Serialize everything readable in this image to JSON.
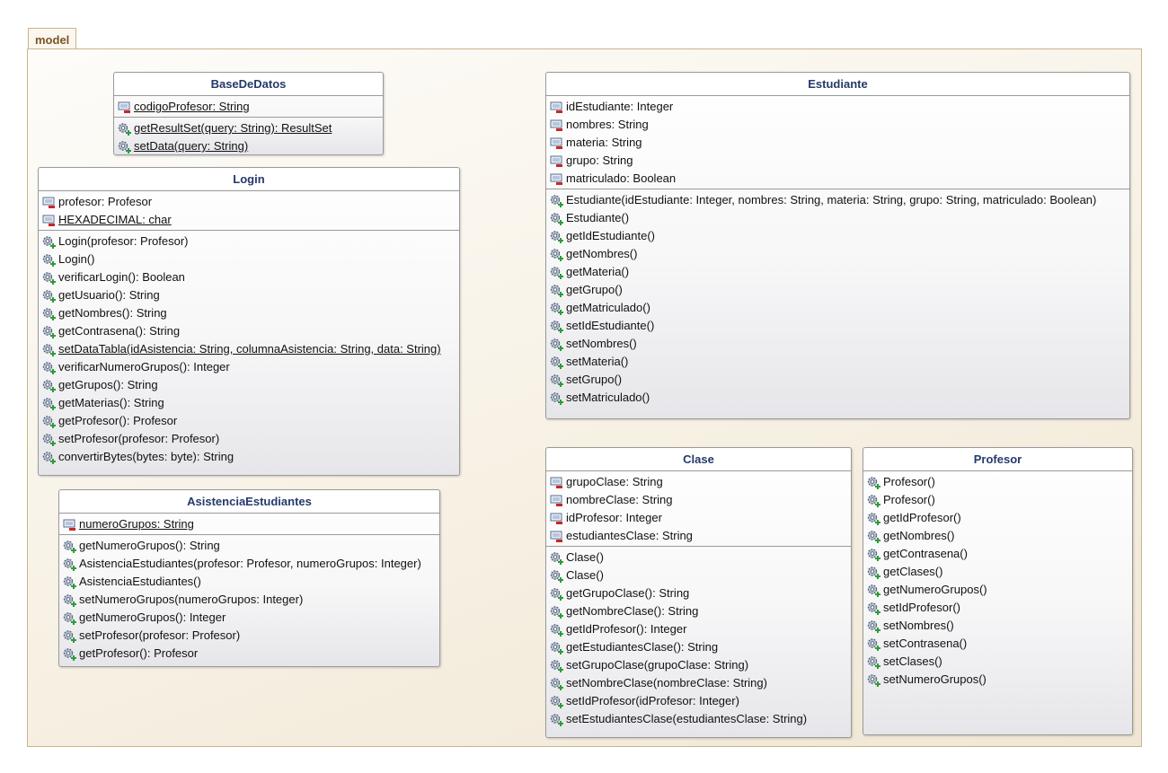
{
  "package": {
    "name": "model"
  },
  "classes": {
    "basededatos": {
      "name": "BaseDeDatos",
      "attributes": [
        {
          "text": "codigoProfesor: String",
          "underline": true
        }
      ],
      "methods": [
        {
          "text": "getResultSet(query: String): ResultSet",
          "underline": true
        },
        {
          "text": "setData(query: String)",
          "underline": true
        }
      ]
    },
    "login": {
      "name": "Login",
      "attributes": [
        {
          "text": "profesor: Profesor",
          "underline": false
        },
        {
          "text": "HEXADECIMAL: char",
          "underline": true
        }
      ],
      "methods": [
        {
          "text": "Login(profesor: Profesor)",
          "underline": false
        },
        {
          "text": "Login()",
          "underline": false
        },
        {
          "text": "verificarLogin(): Boolean",
          "underline": false
        },
        {
          "text": "getUsuario(): String",
          "underline": false
        },
        {
          "text": "getNombres(): String",
          "underline": false
        },
        {
          "text": "getContrasena(): String",
          "underline": false
        },
        {
          "text": "setDataTabla(idAsistencia: String, columnaAsistencia: String, data: String)",
          "underline": true
        },
        {
          "text": "verificarNumeroGrupos(): Integer",
          "underline": false
        },
        {
          "text": "getGrupos(): String",
          "underline": false
        },
        {
          "text": "getMaterias(): String",
          "underline": false
        },
        {
          "text": "getProfesor(): Profesor",
          "underline": false
        },
        {
          "text": "setProfesor(profesor: Profesor)",
          "underline": false
        },
        {
          "text": "convertirBytes(bytes: byte): String",
          "underline": false
        }
      ]
    },
    "asistencia": {
      "name": "AsistenciaEstudiantes",
      "attributes": [
        {
          "text": "numeroGrupos: String",
          "underline": true
        }
      ],
      "methods": [
        {
          "text": "getNumeroGrupos(): String",
          "underline": false
        },
        {
          "text": "AsistenciaEstudiantes(profesor: Profesor, numeroGrupos: Integer)",
          "underline": false
        },
        {
          "text": "AsistenciaEstudiantes()",
          "underline": false
        },
        {
          "text": "setNumeroGrupos(numeroGrupos: Integer)",
          "underline": false
        },
        {
          "text": "getNumeroGrupos(): Integer",
          "underline": false
        },
        {
          "text": "setProfesor(profesor: Profesor)",
          "underline": false
        },
        {
          "text": "getProfesor(): Profesor",
          "underline": false
        }
      ]
    },
    "estudiante": {
      "name": "Estudiante",
      "attributes": [
        {
          "text": "idEstudiante: Integer",
          "underline": false
        },
        {
          "text": "nombres: String",
          "underline": false
        },
        {
          "text": "materia: String",
          "underline": false
        },
        {
          "text": "grupo: String",
          "underline": false
        },
        {
          "text": "matriculado: Boolean",
          "underline": false
        }
      ],
      "methods": [
        {
          "text": "Estudiante(idEstudiante: Integer, nombres: String, materia: String, grupo: String, matriculado: Boolean)",
          "underline": false
        },
        {
          "text": "Estudiante()",
          "underline": false
        },
        {
          "text": "getIdEstudiante()",
          "underline": false
        },
        {
          "text": "getNombres()",
          "underline": false
        },
        {
          "text": "getMateria()",
          "underline": false
        },
        {
          "text": "getGrupo()",
          "underline": false
        },
        {
          "text": "getMatriculado()",
          "underline": false
        },
        {
          "text": "setIdEstudiante()",
          "underline": false
        },
        {
          "text": "setNombres()",
          "underline": false
        },
        {
          "text": "setMateria()",
          "underline": false
        },
        {
          "text": "setGrupo()",
          "underline": false
        },
        {
          "text": "setMatriculado()",
          "underline": false
        }
      ]
    },
    "clase": {
      "name": "Clase",
      "attributes": [
        {
          "text": "grupoClase: String",
          "underline": false
        },
        {
          "text": "nombreClase: String",
          "underline": false
        },
        {
          "text": "idProfesor: Integer",
          "underline": false
        },
        {
          "text": "estudiantesClase: String",
          "underline": false
        }
      ],
      "methods": [
        {
          "text": "Clase()",
          "underline": false
        },
        {
          "text": "Clase()",
          "underline": false
        },
        {
          "text": "getGrupoClase(): String",
          "underline": false
        },
        {
          "text": "getNombreClase(): String",
          "underline": false
        },
        {
          "text": "getIdProfesor(): Integer",
          "underline": false
        },
        {
          "text": "getEstudiantesClase(): String",
          "underline": false
        },
        {
          "text": "setGrupoClase(grupoClase: String)",
          "underline": false
        },
        {
          "text": "setNombreClase(nombreClase: String)",
          "underline": false
        },
        {
          "text": "setIdProfesor(idProfesor: Integer)",
          "underline": false
        },
        {
          "text": "setEstudiantesClase(estudiantesClase: String)",
          "underline": false
        }
      ]
    },
    "profesor": {
      "name": "Profesor",
      "attributes": [],
      "methods": [
        {
          "text": "Profesor()",
          "underline": false
        },
        {
          "text": "Profesor()",
          "underline": false
        },
        {
          "text": "getIdProfesor()",
          "underline": false
        },
        {
          "text": "getNombres()",
          "underline": false
        },
        {
          "text": "getContrasena()",
          "underline": false
        },
        {
          "text": "getClases()",
          "underline": false
        },
        {
          "text": "getNumeroGrupos()",
          "underline": false
        },
        {
          "text": "setIdProfesor()",
          "underline": false
        },
        {
          "text": "setNombres()",
          "underline": false
        },
        {
          "text": "setContrasena()",
          "underline": false
        },
        {
          "text": "setClases()",
          "underline": false
        },
        {
          "text": "setNumeroGrupos()",
          "underline": false
        }
      ]
    }
  },
  "icons": {
    "attribute": "private-field-icon",
    "method": "public-method-icon"
  },
  "colors": {
    "package_label": "#7a5422",
    "class_name": "#243a6b",
    "private_marker": "#c62828",
    "public_marker": "#2e9b3a"
  }
}
